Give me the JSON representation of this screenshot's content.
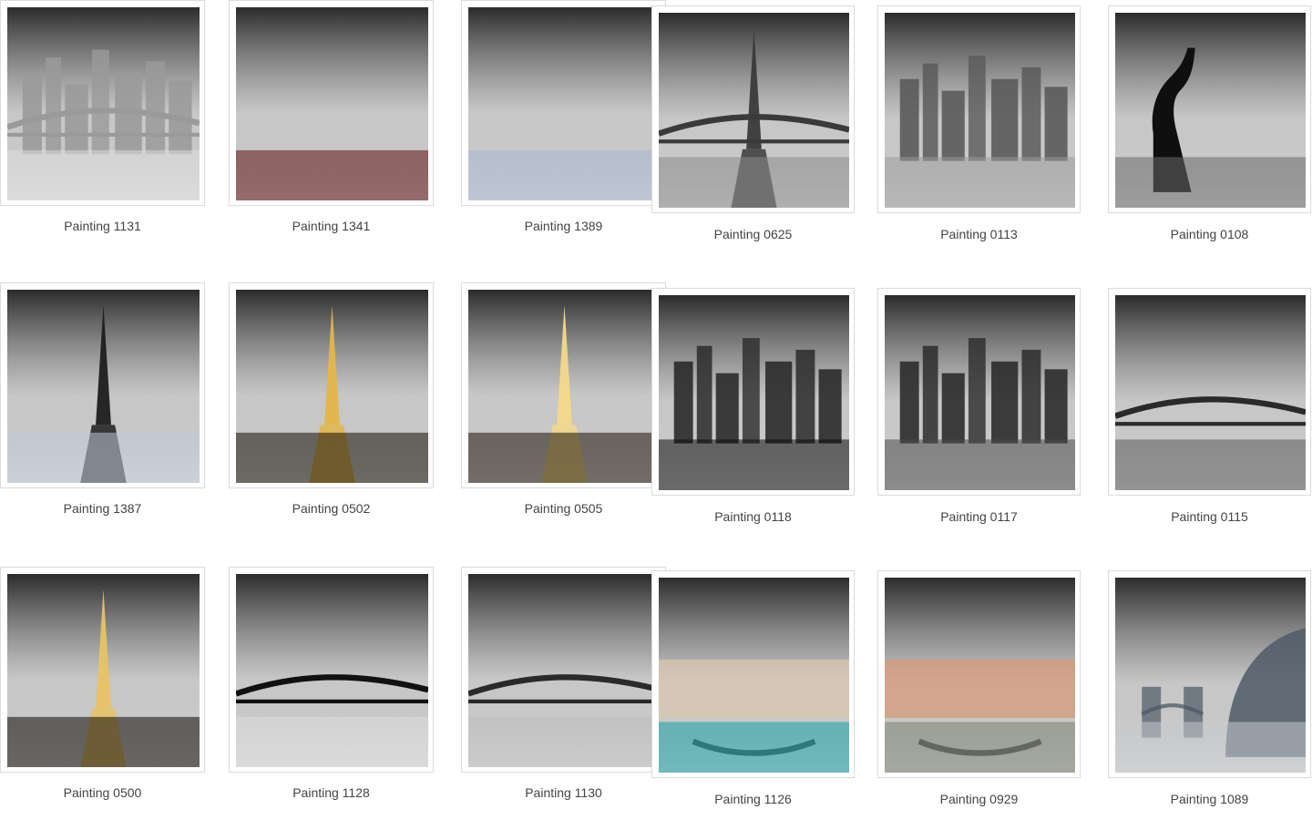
{
  "gallery": {
    "left_rows": [
      [
        {
          "title": "Painting 1131",
          "palette": {
            "sky": "#2b2b2b",
            "mid": "#9a9a9a",
            "ground": "#dcdcdc"
          },
          "motif": "skyline-bridge"
        },
        {
          "title": "Painting 1341",
          "palette": {
            "sky": "#1f3f73",
            "mid": "#e98a2b",
            "ground": "#5b0f0f"
          },
          "motif": "cathedral-night"
        },
        {
          "title": "Painting 1389",
          "palette": {
            "sky": "#dfe4ee",
            "mid": "#6d7080",
            "ground": "#a8b6d0"
          },
          "motif": "gothic-sculpture"
        }
      ],
      [
        {
          "title": "Painting 1387",
          "palette": {
            "sky": "#3d5bd3",
            "mid": "#1d1d1d",
            "ground": "#bfc7d9"
          },
          "motif": "spire"
        },
        {
          "title": "Painting 0502",
          "palette": {
            "sky": "#4a3506",
            "mid": "#e3b64a",
            "ground": "#120c02"
          },
          "motif": "tower-base"
        },
        {
          "title": "Painting 0505",
          "palette": {
            "sky": "#7a5312",
            "mid": "#f3d98a",
            "ground": "#1b1305"
          },
          "motif": "tower-trees"
        }
      ],
      [
        {
          "title": "Painting 0500",
          "palette": {
            "sky": "#1b1305",
            "mid": "#e8c265",
            "ground": "#0b0803"
          },
          "motif": "tower-night"
        },
        {
          "title": "Painting 1128",
          "palette": {
            "sky": "#9a9a9a",
            "mid": "#111111",
            "ground": "#dadada"
          },
          "motif": "bridge-lights"
        },
        {
          "title": "Painting 1130",
          "palette": {
            "sky": "#6a6a6a",
            "mid": "#2a2a2a",
            "ground": "#bdbdbd"
          },
          "motif": "bridge-river"
        }
      ]
    ],
    "right_rows": [
      [
        {
          "title": "Painting 0625",
          "palette": {
            "sky": "#efefef",
            "mid": "#3a3a3a",
            "ground": "#8a8a8a"
          },
          "motif": "tower-bridge"
        },
        {
          "title": "Painting 0113",
          "palette": {
            "sky": "#f2f2f2",
            "mid": "#5a5a5a",
            "ground": "#9a9a9a"
          },
          "motif": "skyline"
        },
        {
          "title": "Painting 0108",
          "palette": {
            "sky": "#cfcfcf",
            "mid": "#0f0f0f",
            "ground": "#6a6a6a"
          },
          "motif": "statue"
        }
      ],
      [
        {
          "title": "Painting 0118",
          "palette": {
            "sky": "#dcdcdc",
            "mid": "#2a2a2a",
            "ground": "#0d0d0d"
          },
          "motif": "city-aerial"
        },
        {
          "title": "Painting 0117",
          "palette": {
            "sky": "#e9e9e9",
            "mid": "#2b2b2b",
            "ground": "#4a4a4a"
          },
          "motif": "trees-skyline"
        },
        {
          "title": "Painting 0115",
          "palette": {
            "sky": "#bdbdbd",
            "mid": "#2a2a2a",
            "ground": "#5a5a5a"
          },
          "motif": "bridge-aerial"
        }
      ],
      [
        {
          "title": "Painting 1126",
          "palette": {
            "sky": "#2b5aa8",
            "mid": "#d8c7b0",
            "ground": "#1b9da4"
          },
          "motif": "venice-canal"
        },
        {
          "title": "Painting 0929",
          "palette": {
            "sky": "#d7dde3",
            "mid": "#d59b78",
            "ground": "#7a7f6f"
          },
          "motif": "venice-gondola"
        },
        {
          "title": "Painting 1089",
          "palette": {
            "sky": "#a6bdd6",
            "mid": "#4d5a66",
            "ground": "#c4c8cc"
          },
          "motif": "london-dome"
        }
      ]
    ]
  }
}
